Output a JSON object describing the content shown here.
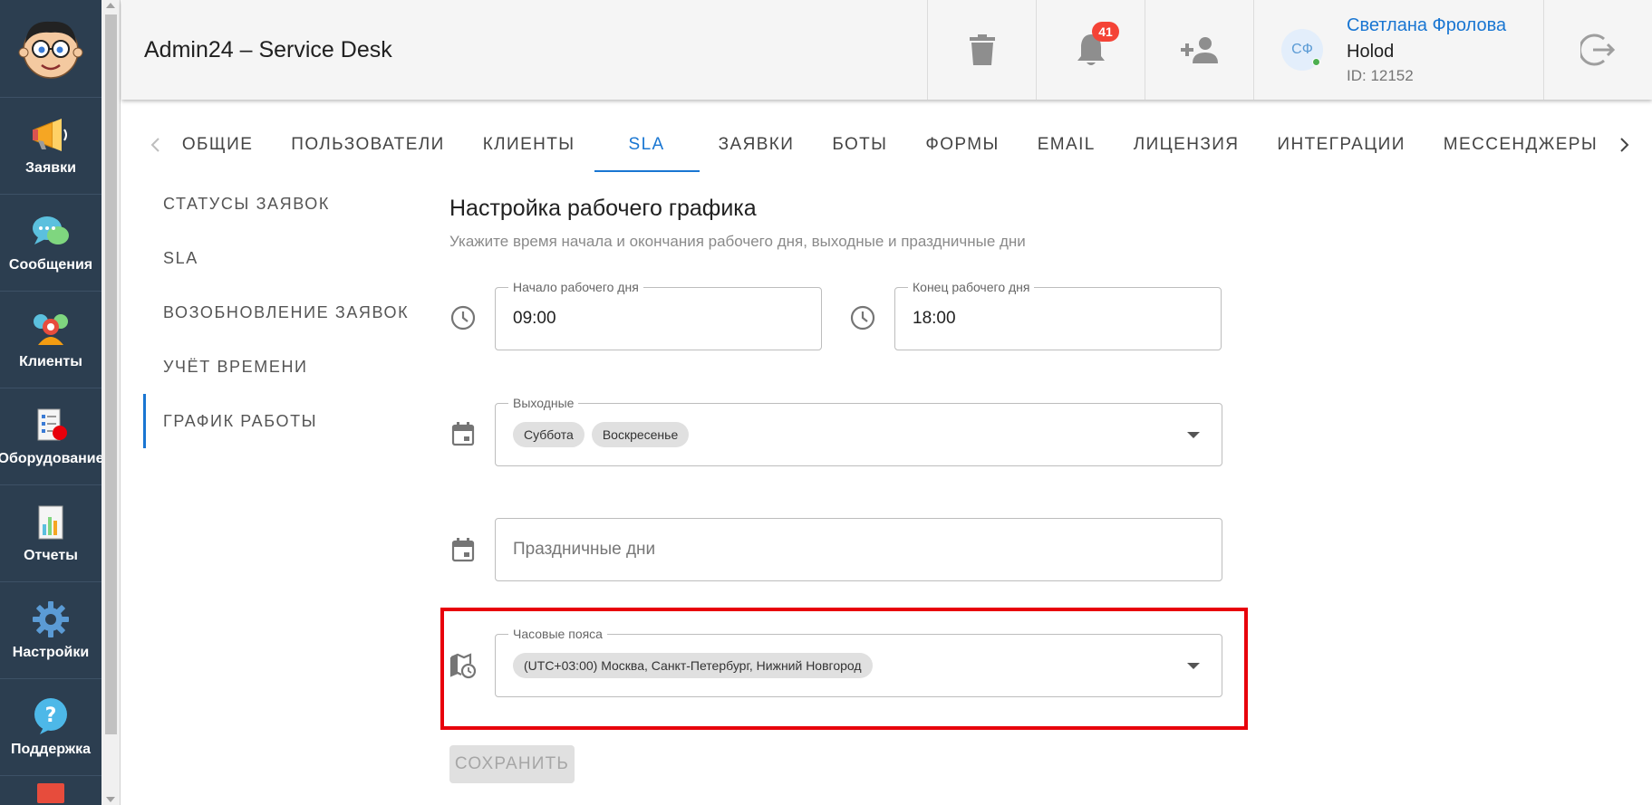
{
  "header": {
    "title": "Admin24 – Service Desk",
    "notifications_count": "41",
    "user": {
      "initials": "СФ",
      "name": "Светлана Фролова",
      "org": "Holod",
      "id": "ID: 12152"
    }
  },
  "sidebar": {
    "items": [
      {
        "label": "Заявки",
        "icon": "megaphone-icon"
      },
      {
        "label": "Сообщения",
        "icon": "chat-bubble-icon"
      },
      {
        "label": "Клиенты",
        "icon": "people-icon"
      },
      {
        "label": "Оборудование",
        "icon": "equipment-checklist-icon"
      },
      {
        "label": "Отчеты",
        "icon": "bar-chart-report-icon"
      },
      {
        "label": "Настройки",
        "icon": "gear-icon"
      },
      {
        "label": "Поддержка",
        "icon": "question-icon"
      }
    ]
  },
  "tabs": [
    {
      "label": "ОБЩИЕ",
      "active": false
    },
    {
      "label": "ПОЛЬЗОВАТЕЛИ",
      "active": false
    },
    {
      "label": "КЛИЕНТЫ",
      "active": false
    },
    {
      "label": "SLA",
      "active": true
    },
    {
      "label": "ЗАЯВКИ",
      "active": false
    },
    {
      "label": "БОТЫ",
      "active": false
    },
    {
      "label": "ФОРМЫ",
      "active": false
    },
    {
      "label": "EMAIL",
      "active": false
    },
    {
      "label": "ЛИЦЕНЗИЯ",
      "active": false
    },
    {
      "label": "ИНТЕГРАЦИИ",
      "active": false
    },
    {
      "label": "МЕССЕНДЖЕРЫ",
      "active": false
    }
  ],
  "subnav": [
    {
      "label": "СТАТУСЫ ЗАЯВОК",
      "active": false
    },
    {
      "label": "SLA",
      "active": false
    },
    {
      "label": "ВОЗОБНОВЛЕНИЕ ЗАЯВОК",
      "active": false
    },
    {
      "label": "УЧЁТ ВРЕМЕНИ",
      "active": false
    },
    {
      "label": "ГРАФИК РАБОТЫ",
      "active": true
    }
  ],
  "form": {
    "title": "Настройка рабочего графика",
    "subtitle": "Укажите время начала и окончания рабочего дня, выходные и праздничные дни",
    "start": {
      "label": "Начало рабочего дня",
      "value": "09:00"
    },
    "end": {
      "label": "Конец рабочего дня",
      "value": "18:00"
    },
    "weekends": {
      "label": "Выходные",
      "chips": [
        "Суббота",
        "Воскресенье"
      ]
    },
    "holidays": {
      "placeholder": "Праздничные дни"
    },
    "timezones": {
      "label": "Часовые пояса",
      "chips": [
        "(UTC+03:00) Москва, Санкт-Петербург, Нижний Новгород"
      ]
    },
    "save_label": "СОХРАНИТЬ"
  },
  "colors": {
    "accent": "#1976d2",
    "sidebar_bg": "#2c3e50",
    "badge": "#f44336",
    "highlight": "#e8000b"
  }
}
